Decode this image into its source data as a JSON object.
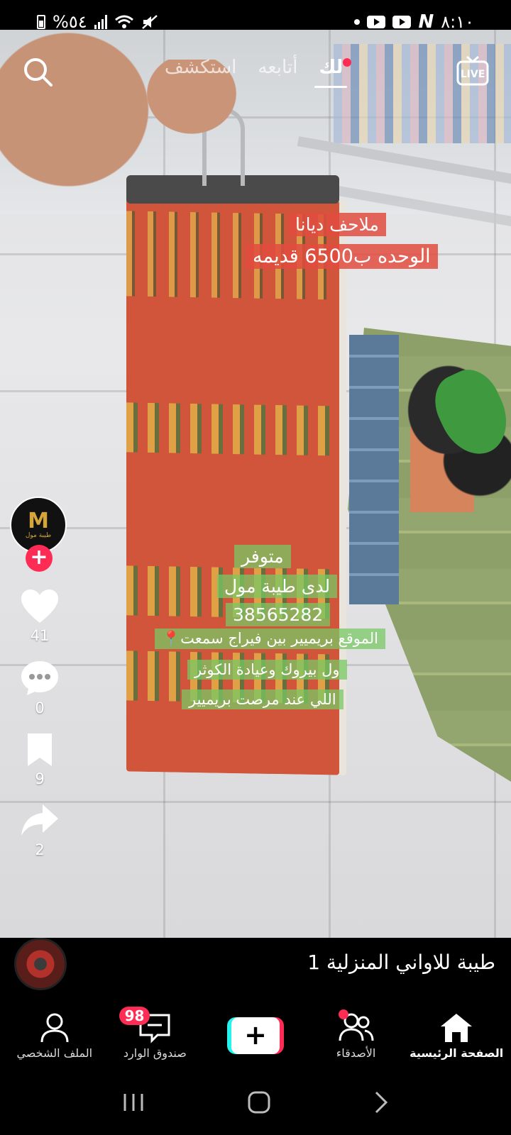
{
  "status_bar": {
    "time": "٨:١٠",
    "battery": "%٥٤"
  },
  "top_nav": {
    "tabs": [
      {
        "label": "لك",
        "active": true,
        "has_dot": true
      },
      {
        "label": "أتابعه",
        "active": false
      },
      {
        "label": "استكشف",
        "active": false
      }
    ],
    "live_label": "LIVE"
  },
  "overlay_text": {
    "title_line1": "ملاحف ديانا",
    "title_line2": "الوحده ب6500 قديمه",
    "info_lines": [
      "متوفر",
      "لدى طيبة مول",
      "38565282",
      "📍الموقع بريميير بين فيراج سمعت",
      "ول بيروك وعيادة الكوثر",
      "اللي عند مرصت بريميير"
    ]
  },
  "creator": {
    "avatar_mark": "M",
    "avatar_text": "طيبة مول"
  },
  "actions": {
    "likes": "41",
    "comments": "0",
    "saves": "9",
    "shares": "2"
  },
  "sound": {
    "title": "طيبة للاواني المنزلية 1"
  },
  "tab_bar": {
    "home": "الصفحة الرئيسية",
    "friends": "الأصدقاء",
    "create": "+",
    "inbox": "صندوق الوارد",
    "inbox_badge": "98",
    "profile": "الملف الشخصي"
  },
  "colors": {
    "accent_red": "#fe2c55",
    "accent_cyan": "#25f4ee",
    "caption_red": "#e24c40",
    "caption_green": "#78c864"
  }
}
